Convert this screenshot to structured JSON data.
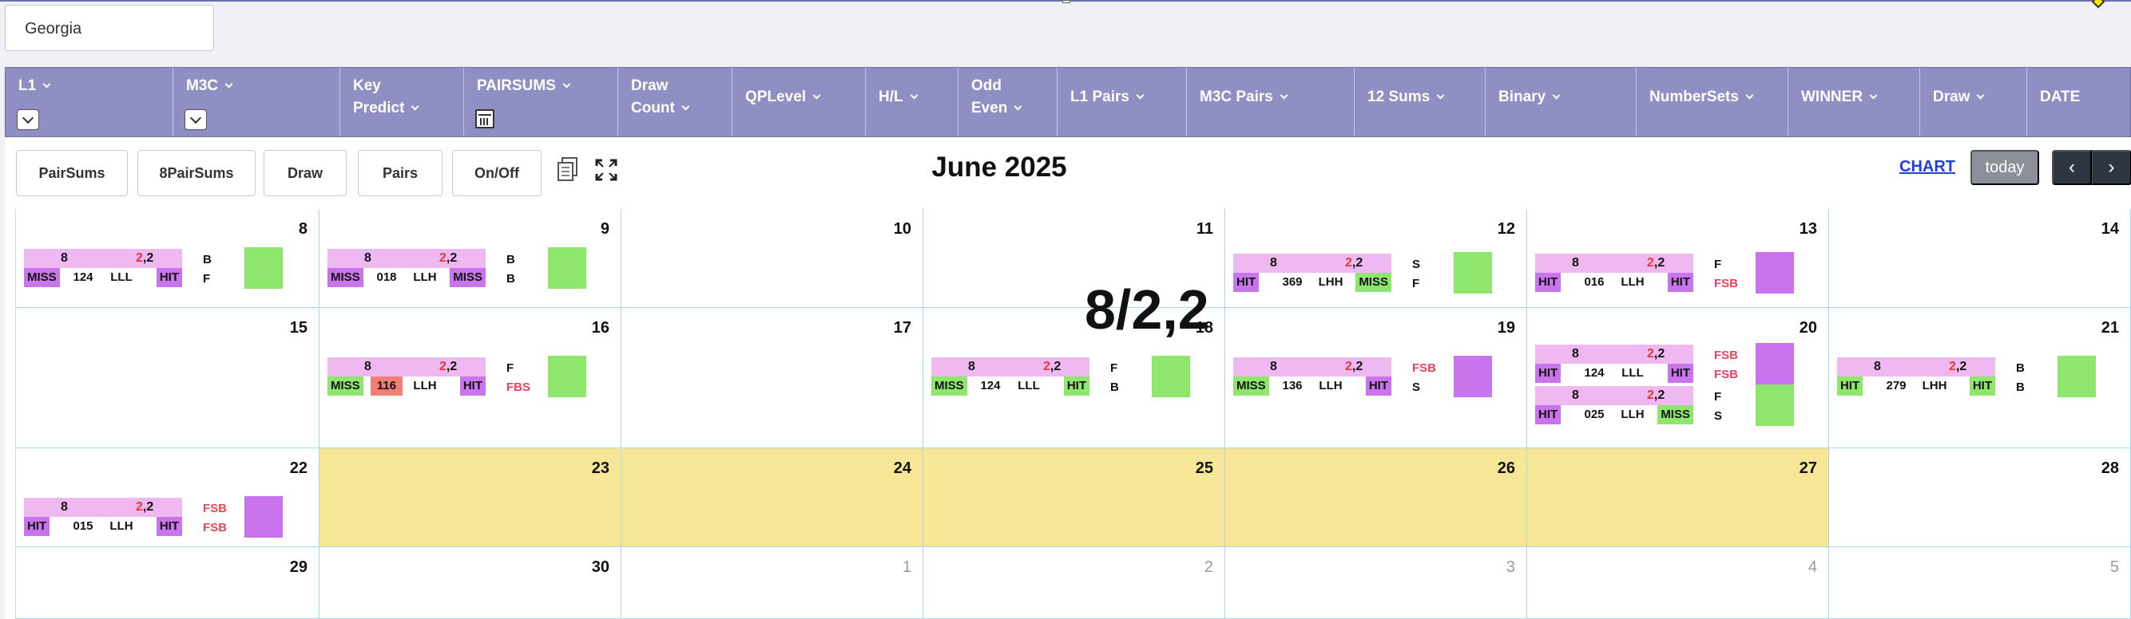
{
  "state_select": {
    "value": "Georgia"
  },
  "filters": [
    {
      "label1": "L1",
      "label2": "",
      "drop": true,
      "cal": false
    },
    {
      "label1": "M3C",
      "label2": "",
      "drop": true,
      "cal": false
    },
    {
      "label1": "Key",
      "label2": "Predict",
      "drop": false,
      "cal": false
    },
    {
      "label1": "PAIRSUMS",
      "label2": "",
      "drop": false,
      "cal": true
    },
    {
      "label1": "Draw",
      "label2": "Count",
      "drop": false,
      "cal": false
    },
    {
      "label1": "QPLevel",
      "label2": "",
      "drop": false,
      "cal": false
    },
    {
      "label1": "H/L",
      "label2": "",
      "drop": false,
      "cal": false
    },
    {
      "label1": "Odd",
      "label2": "Even",
      "drop": false,
      "cal": false
    },
    {
      "label1": "L1 Pairs",
      "label2": "",
      "drop": false,
      "cal": false
    },
    {
      "label1": "M3C Pairs",
      "label2": "",
      "drop": false,
      "cal": false
    },
    {
      "label1": "12 Sums",
      "label2": "",
      "drop": false,
      "cal": false
    },
    {
      "label1": "Binary",
      "label2": "",
      "drop": false,
      "cal": false
    },
    {
      "label1": "NumberSets",
      "label2": "",
      "drop": false,
      "cal": false
    },
    {
      "label1": "WINNER",
      "label2": "",
      "drop": false,
      "cal": false
    },
    {
      "label1": "Draw",
      "label2": "",
      "drop": false,
      "cal": false
    },
    {
      "label1": "DATE",
      "label2": "",
      "drop": false,
      "cal": false
    }
  ],
  "toolbar": {
    "buttons": [
      "PairSums",
      "8PairSums",
      "Draw",
      "Pairs",
      "On/Off"
    ],
    "month_title": "June 2025",
    "chart_link": "CHART",
    "today": "today",
    "prev": "‹",
    "next": "›"
  },
  "calendar": {
    "big_result": "8/2,2",
    "weeks": [
      {
        "days": [
          {
            "num": "8",
            "yellow": false,
            "other": false,
            "entries": [
              {
                "n": "8",
                "p1": "2",
                "p2": ",2",
                "b1": "MISS",
                "b1c": "purple",
                "num": "124",
                "numhl": false,
                "hl": "LLL",
                "b2": "HIT",
                "b2c": "purple",
                "l1": "B",
                "l1red": false,
                "l2": "F",
                "l2red": false,
                "sq": "green"
              }
            ]
          },
          {
            "num": "9",
            "yellow": false,
            "other": false,
            "entries": [
              {
                "n": "8",
                "p1": "2",
                "p2": ",2",
                "b1": "MISS",
                "b1c": "purple",
                "num": "018",
                "numhl": false,
                "hl": "LLH",
                "b2": "MISS",
                "b2c": "purple",
                "l1": "B",
                "l1red": false,
                "l2": "B",
                "l2red": false,
                "sq": "green"
              }
            ]
          },
          {
            "num": "10",
            "yellow": false,
            "other": false,
            "entries": []
          },
          {
            "num": "11",
            "yellow": false,
            "other": false,
            "entries": []
          },
          {
            "num": "12",
            "yellow": false,
            "other": false,
            "entries": [
              {
                "n": "8",
                "p1": "2",
                "p2": ",2",
                "b1": "HIT",
                "b1c": "purple",
                "num": "369",
                "numhl": false,
                "hl": "LHH",
                "b2": "MISS",
                "b2c": "green",
                "l1": "S",
                "l1red": false,
                "l2": "F",
                "l2red": false,
                "sq": "green"
              }
            ]
          },
          {
            "num": "13",
            "yellow": false,
            "other": false,
            "entries": [
              {
                "n": "8",
                "p1": "2",
                "p2": ",2",
                "b1": "HIT",
                "b1c": "purple",
                "num": "016",
                "numhl": false,
                "hl": "LLH",
                "b2": "HIT",
                "b2c": "purple",
                "l1": "F",
                "l1red": false,
                "l2": "FSB",
                "l2red": true,
                "sq": "purple"
              }
            ]
          },
          {
            "num": "14",
            "yellow": false,
            "other": false,
            "entries": []
          }
        ]
      },
      {
        "days": [
          {
            "num": "15",
            "yellow": false,
            "other": false,
            "entries": []
          },
          {
            "num": "16",
            "yellow": false,
            "other": false,
            "entries": [
              {
                "n": "8",
                "p1": "2",
                "p2": ",2",
                "b1": "MISS",
                "b1c": "green",
                "num": "116",
                "numhl": true,
                "hl": "LLH",
                "b2": "HIT",
                "b2c": "purple",
                "l1": "F",
                "l1red": false,
                "l2": "FBS",
                "l2red": true,
                "sq": "green"
              }
            ]
          },
          {
            "num": "17",
            "yellow": false,
            "other": false,
            "entries": []
          },
          {
            "num": "18",
            "yellow": false,
            "other": false,
            "entries": [
              {
                "n": "8",
                "p1": "2",
                "p2": ",2",
                "b1": "MISS",
                "b1c": "green",
                "num": "124",
                "numhl": false,
                "hl": "LLL",
                "b2": "HIT",
                "b2c": "green",
                "l1": "F",
                "l1red": false,
                "l2": "B",
                "l2red": false,
                "sq": "green"
              }
            ]
          },
          {
            "num": "19",
            "yellow": false,
            "other": false,
            "entries": [
              {
                "n": "8",
                "p1": "2",
                "p2": ",2",
                "b1": "MISS",
                "b1c": "green",
                "num": "136",
                "numhl": false,
                "hl": "LLH",
                "b2": "HIT",
                "b2c": "purple",
                "l1": "FSB",
                "l1red": true,
                "l2": "S",
                "l2red": false,
                "sq": "purple"
              }
            ]
          },
          {
            "num": "20",
            "yellow": false,
            "other": false,
            "entries": [
              {
                "n": "8",
                "p1": "2",
                "p2": ",2",
                "b1": "HIT",
                "b1c": "purple",
                "num": "124",
                "numhl": false,
                "hl": "LLL",
                "b2": "HIT",
                "b2c": "purple",
                "l1": "FSB",
                "l1red": true,
                "l2": "FSB",
                "l2red": true,
                "sq": "purple"
              },
              {
                "n": "8",
                "p1": "2",
                "p2": ",2",
                "b1": "HIT",
                "b1c": "purple",
                "num": "025",
                "numhl": false,
                "hl": "LLH",
                "b2": "MISS",
                "b2c": "green",
                "l1": "F",
                "l1red": false,
                "l2": "S",
                "l2red": false,
                "sq": "green"
              }
            ]
          },
          {
            "num": "21",
            "yellow": false,
            "other": false,
            "entries": [
              {
                "n": "8",
                "p1": "2",
                "p2": ",2",
                "b1": "HIT",
                "b1c": "green",
                "num": "279",
                "numhl": false,
                "hl": "LHH",
                "b2": "HIT",
                "b2c": "green",
                "l1": "B",
                "l1red": false,
                "l2": "B",
                "l2red": false,
                "sq": "green"
              }
            ]
          }
        ]
      },
      {
        "days": [
          {
            "num": "22",
            "yellow": false,
            "other": false,
            "entries": [
              {
                "n": "8",
                "p1": "2",
                "p2": ",2",
                "b1": "HIT",
                "b1c": "purple",
                "num": "015",
                "numhl": false,
                "hl": "LLH",
                "b2": "HIT",
                "b2c": "purple",
                "l1": "FSB",
                "l1red": true,
                "l2": "FSB",
                "l2red": true,
                "sq": "purple"
              }
            ]
          },
          {
            "num": "23",
            "yellow": true,
            "other": false,
            "entries": []
          },
          {
            "num": "24",
            "yellow": true,
            "other": false,
            "entries": []
          },
          {
            "num": "25",
            "yellow": true,
            "other": false,
            "entries": []
          },
          {
            "num": "26",
            "yellow": true,
            "other": false,
            "entries": []
          },
          {
            "num": "27",
            "yellow": true,
            "other": false,
            "entries": []
          },
          {
            "num": "28",
            "yellow": false,
            "other": false,
            "entries": []
          }
        ]
      },
      {
        "days": [
          {
            "num": "29",
            "yellow": false,
            "other": false,
            "entries": []
          },
          {
            "num": "30",
            "yellow": false,
            "other": false,
            "entries": []
          },
          {
            "num": "1",
            "yellow": false,
            "other": true,
            "entries": []
          },
          {
            "num": "2",
            "yellow": false,
            "other": true,
            "entries": []
          },
          {
            "num": "3",
            "yellow": false,
            "other": true,
            "entries": []
          },
          {
            "num": "4",
            "yellow": false,
            "other": true,
            "entries": []
          },
          {
            "num": "5",
            "yellow": false,
            "other": true,
            "entries": []
          }
        ]
      }
    ]
  }
}
